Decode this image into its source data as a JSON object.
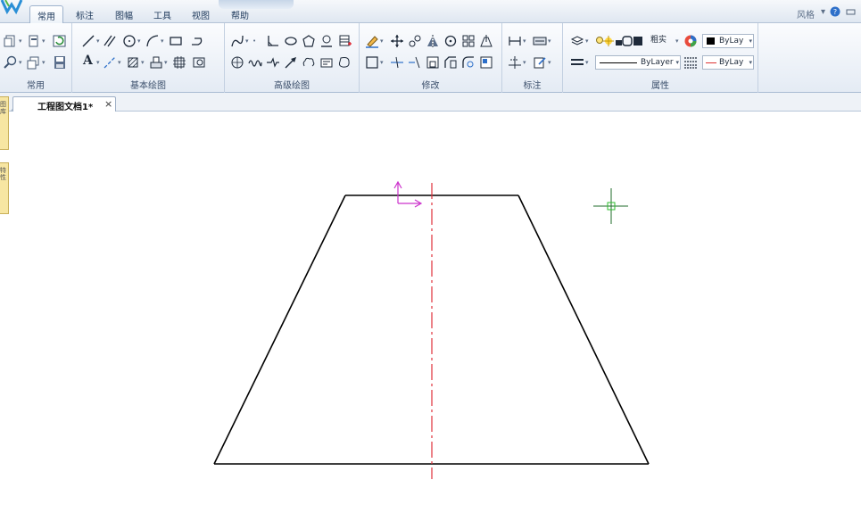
{
  "menubar": {
    "tabs": [
      {
        "label": "常用",
        "active": true
      },
      {
        "label": "标注",
        "active": false
      },
      {
        "label": "图幅",
        "active": false
      },
      {
        "label": "工具",
        "active": false
      },
      {
        "label": "视图",
        "active": false
      },
      {
        "label": "帮助",
        "active": false
      }
    ],
    "style_label": "风格",
    "help_icon": "help-icon",
    "minimize_icon": "minimize-ribbon-icon"
  },
  "ribbon": {
    "groups": {
      "common": "常用",
      "basic_draw": "基本绘图",
      "advanced_draw": "高级绘图",
      "modify": "修改",
      "dimension": "标注",
      "properties": "属性"
    },
    "properties": {
      "linetype_label": "粗实",
      "color_combo": "ByLay",
      "linetype_combo": "ByLayer",
      "lineweight_combo": "ByLay"
    },
    "text_tool_glyph": "A"
  },
  "document": {
    "tab_label": "工程图文档1*",
    "close_glyph": "×"
  },
  "side": {
    "panel1": "图库",
    "panel2": "特性"
  },
  "colors": {
    "drawing_line": "#000000",
    "centerline": "#e0303a",
    "ucs_axis": "#cc33cc",
    "cursor": "#1f6b28",
    "ribbon_bg": "#e4ebf4",
    "panel_yellow": "#f7e6a2"
  }
}
